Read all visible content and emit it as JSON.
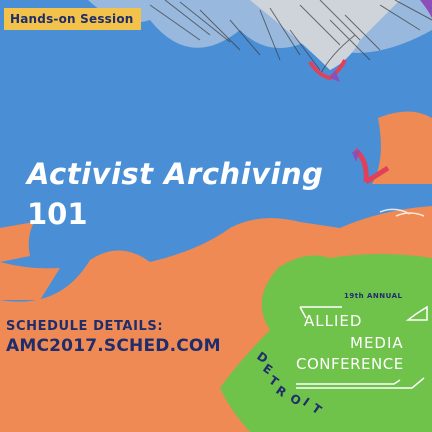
{
  "badge": {
    "label": "Hands-on Session"
  },
  "title": {
    "line1": "Activist Archiving",
    "line2": "101"
  },
  "schedule": {
    "label": "SCHEDULE DETAILS:",
    "url": "AMC2017.SCHED.COM"
  },
  "logo": {
    "annual": "19th ANNUAL",
    "allied": "ALLIED",
    "media": "MEDIA",
    "conference": "CONFERENCE"
  },
  "city": {
    "letters": [
      "D",
      "E",
      "T",
      "R",
      "O",
      "I",
      "T"
    ]
  },
  "colors": {
    "blue": "#4a8fd6",
    "orange": "#f08a55",
    "green": "#6fc24a",
    "yellow": "#f3c24a",
    "navy": "#1f2d6b",
    "purple": "#8a4fb8"
  }
}
